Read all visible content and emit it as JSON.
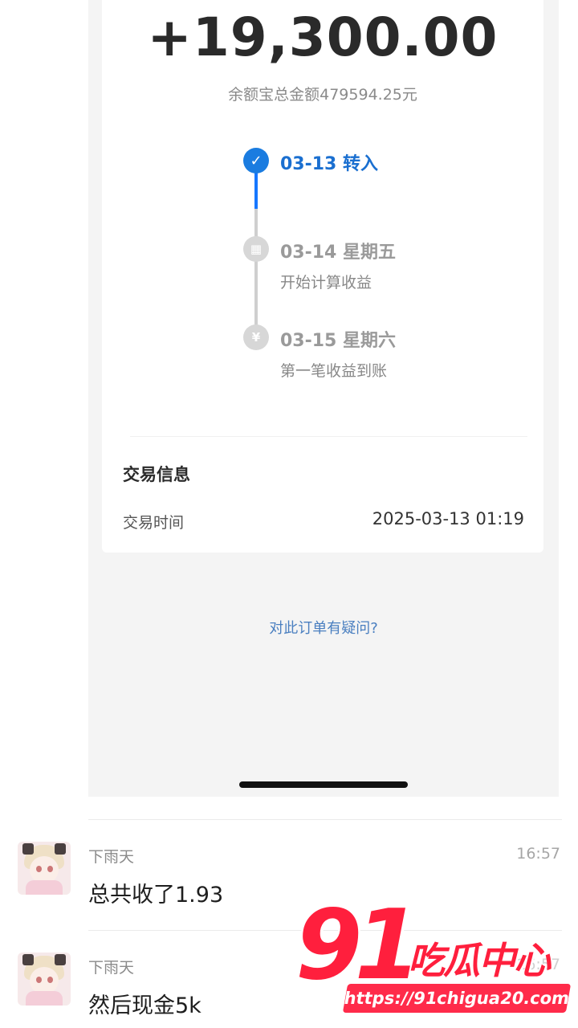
{
  "transaction": {
    "amount": "+19,300.00",
    "total_balance": "余额宝总金额479594.25元",
    "timeline": [
      {
        "title": "03-13 转入",
        "subtitle": "",
        "state": "done",
        "icon": "check-icon"
      },
      {
        "title": "03-14 星期五",
        "subtitle": "开始计算收益",
        "state": "pending",
        "icon": "calculator-icon"
      },
      {
        "title": "03-15 星期六",
        "subtitle": "第一笔收益到账",
        "state": "pending",
        "icon": "yen-icon"
      }
    ],
    "section_title": "交易信息",
    "time_label": "交易时间",
    "time_value": "2025-03-13 01:19",
    "question_link": "对此订单有疑问?"
  },
  "chat": {
    "messages": [
      {
        "sender": "下雨天",
        "text": "总共收了1.93",
        "time": "16:57"
      },
      {
        "sender": "下雨天",
        "text": "然后现金5k",
        "time": "16:57"
      }
    ]
  },
  "watermark": {
    "number": "91",
    "text": "吃瓜中心",
    "url": "https://91chigua20.com"
  },
  "colors": {
    "accent_blue": "#1a7ce0",
    "watermark_red": "#ff1f3d"
  }
}
